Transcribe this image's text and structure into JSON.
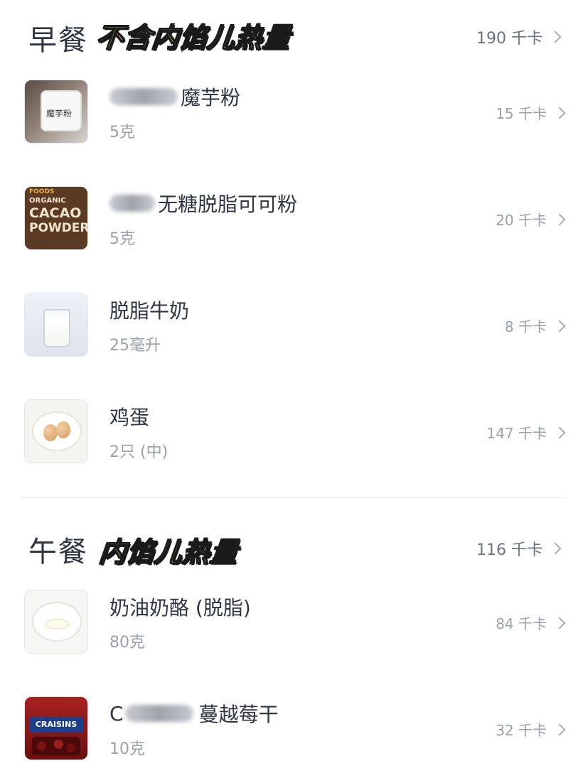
{
  "breakfast": {
    "title": "早餐",
    "sticker": "不含内馅儿热量",
    "total": "190 千卡",
    "items": [
      {
        "name": "魔芋粉",
        "qty": "5克",
        "kcal": "15 千卡",
        "thumb_label": "魔芋粉"
      },
      {
        "name": "无糖脱脂可可粉",
        "qty": "5克",
        "kcal": "20 千卡",
        "thumb_lines": [
          "FOODS",
          "ORGANIC",
          "CACAO",
          "POWDER"
        ]
      },
      {
        "name": "脱脂牛奶",
        "qty": "25毫升",
        "kcal": "8 千卡"
      },
      {
        "name": "鸡蛋",
        "qty": "2只 (中)",
        "kcal": "147 千卡"
      }
    ]
  },
  "lunch": {
    "title": "午餐",
    "sticker": "内馅儿热量",
    "total": "116 千卡",
    "items": [
      {
        "name": "奶油奶酪 (脱脂)",
        "qty": "80克",
        "kcal": "84 千卡"
      },
      {
        "name_prefix": "C",
        "name": "蔓越莓干",
        "qty": "10克",
        "kcal": "32 千卡",
        "thumb_label": "CRAISINS"
      }
    ]
  },
  "colors": {
    "sticker_fill": "#fff27a",
    "text_primary": "#2f3542",
    "text_muted": "#9aa0a8"
  },
  "icons": {
    "row_chevron": "chevron-right-icon"
  }
}
